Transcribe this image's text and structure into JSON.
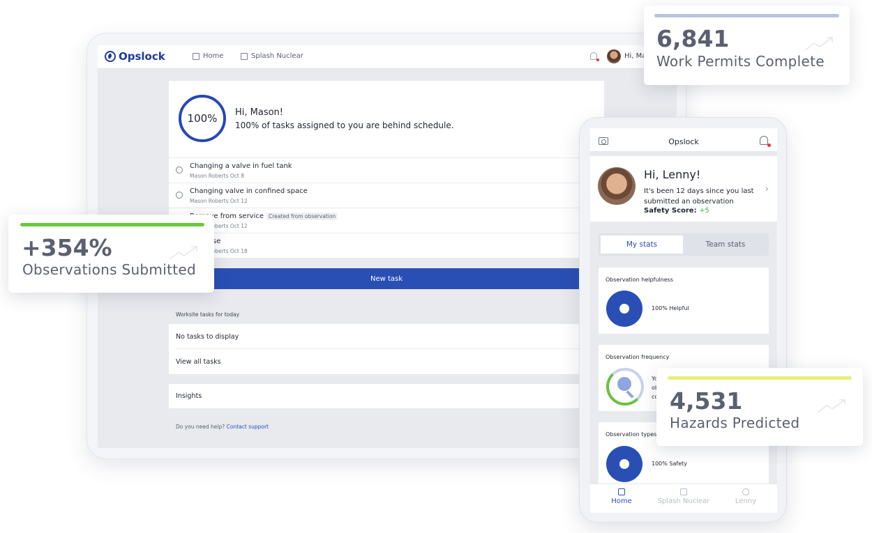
{
  "tablet": {
    "brand": "Opslock",
    "nav": {
      "home": "Home",
      "site": "Splash Nuclear",
      "greeting": "Hi, Ma"
    },
    "progress": "100%",
    "greeting_title": "Hi, Mason!",
    "greeting_sub": "100% of tasks assigned to you are behind schedule.",
    "chevron": "›",
    "tasks": [
      {
        "name": "Changing a valve in fuel tank",
        "meta": "Mason Roberts    Oct 8",
        "tag": ""
      },
      {
        "name": "Changing valve in confined space",
        "meta": "Mason Roberts    Oct 12",
        "tag": ""
      },
      {
        "name": "Remove from service",
        "meta": "Mason Roberts    Oct 12",
        "tag": "Created from observation"
      },
      {
        "name": "High rise",
        "meta": "Mason Roberts    Oct 18",
        "tag": ""
      }
    ],
    "new_task": "New task",
    "worksite_label": "Worksite tasks for today",
    "no_tasks": "No tasks to display",
    "view_all": "View all tasks",
    "insights": "Insights",
    "help_text": "Do you need help?",
    "help_link": "Contact support"
  },
  "phone": {
    "title": "Opslock",
    "hi": "Hi, Lenny!",
    "message": "It's been 12 days since you last submitted an observation",
    "score_label": "Safety Score:",
    "score_value": "+5",
    "chevron": "›",
    "tabs": {
      "mine": "My stats",
      "team": "Team stats"
    },
    "helpfulness_title": "Observation helpfulness",
    "helpfulness_value": "100% Helpful",
    "frequency_title": "Observation frequency",
    "frequency_text_1": "Yo",
    "frequency_text_2": "ob",
    "frequency_text_3": "co",
    "types_title": "Observation types",
    "types_value": "100% Safety",
    "bottom_tabs": {
      "home": "Home",
      "site": "Splash Nuclear",
      "user": "Lenny"
    }
  },
  "floating": {
    "permits": {
      "number": "6,841",
      "label": "Work Permits Complete",
      "bar_color": "#b8c3e3"
    },
    "observations": {
      "number": "+354%",
      "label": "Observations Submitted",
      "bar_color": "#6bc93a"
    },
    "hazards": {
      "number": "4,531",
      "label": "Hazards Predicted",
      "bar_color": "#e6ef7a"
    }
  },
  "colors": {
    "primary": "#2a4fb4",
    "brand": "#1f3a9e",
    "positive": "#46b940",
    "alert": "#e0393e"
  },
  "icons": {
    "logo": "leaf-logo-icon",
    "home": "home-icon",
    "site": "building-icon",
    "bell": "bell-icon",
    "camera": "camera-icon",
    "user": "user-icon",
    "trend": "trend-up-icon",
    "search": "search-icon"
  }
}
